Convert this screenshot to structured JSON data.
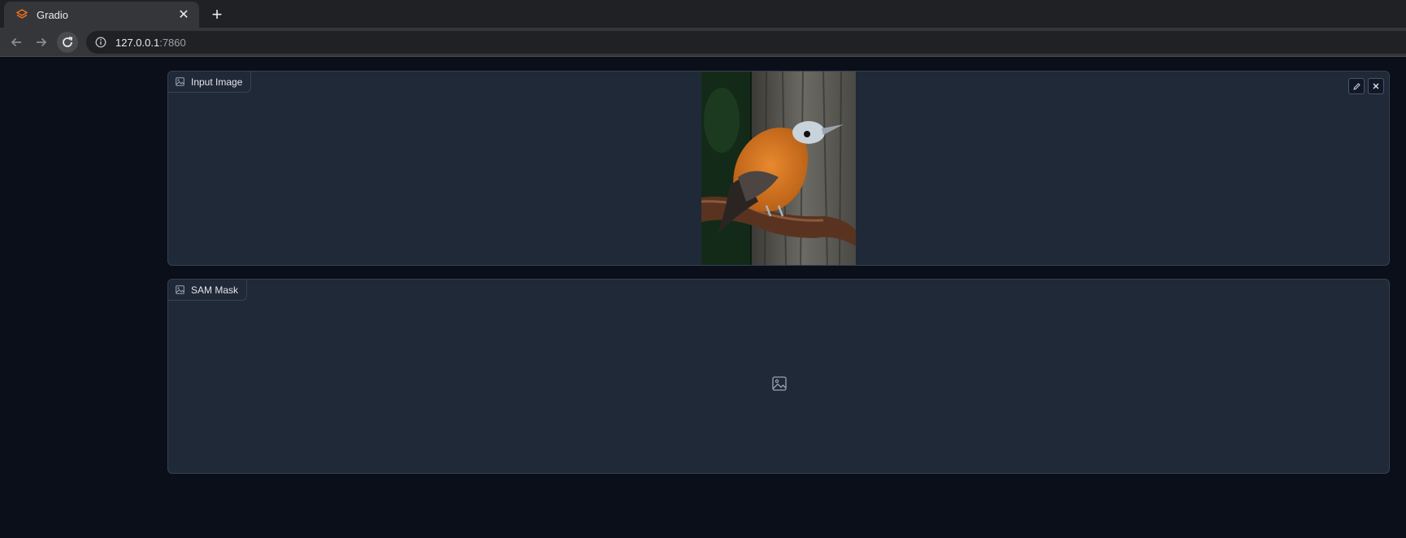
{
  "browser": {
    "tab_title": "Gradio",
    "url_host": "127.0.0.1",
    "url_port": ":7860"
  },
  "input_image": {
    "label": "Input Image",
    "has_image": true
  },
  "sam_mask": {
    "label": "SAM Mask",
    "empty": true
  },
  "icons": {
    "favicon": "gradio-logo-icon",
    "tab_close": "close-icon",
    "new_tab": "plus-icon",
    "back": "arrow-left-icon",
    "forward": "arrow-right-icon",
    "reload": "reload-icon",
    "site_info": "info-icon",
    "label": "image-icon",
    "edit": "pencil-icon",
    "clear": "close-icon",
    "placeholder": "image-placeholder-icon"
  },
  "colors": {
    "accent": "#f97316",
    "page_bg": "#0b0f19",
    "panel_bg": "#1f2937",
    "panel_border": "#374151"
  }
}
